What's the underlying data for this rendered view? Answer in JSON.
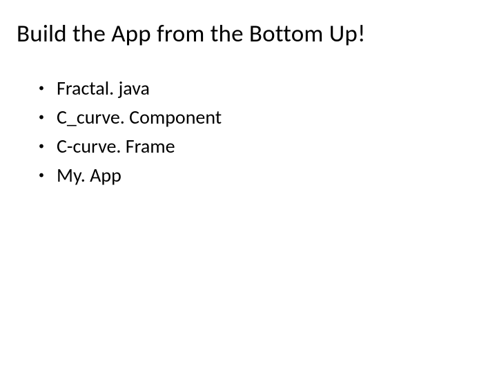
{
  "title": "Build the App from the Bottom Up!",
  "bullets": {
    "items": [
      {
        "text": "Fractal. java"
      },
      {
        "text": "C_curve. Component"
      },
      {
        "text": "C-curve. Frame"
      },
      {
        "text": "My. App"
      }
    ]
  }
}
